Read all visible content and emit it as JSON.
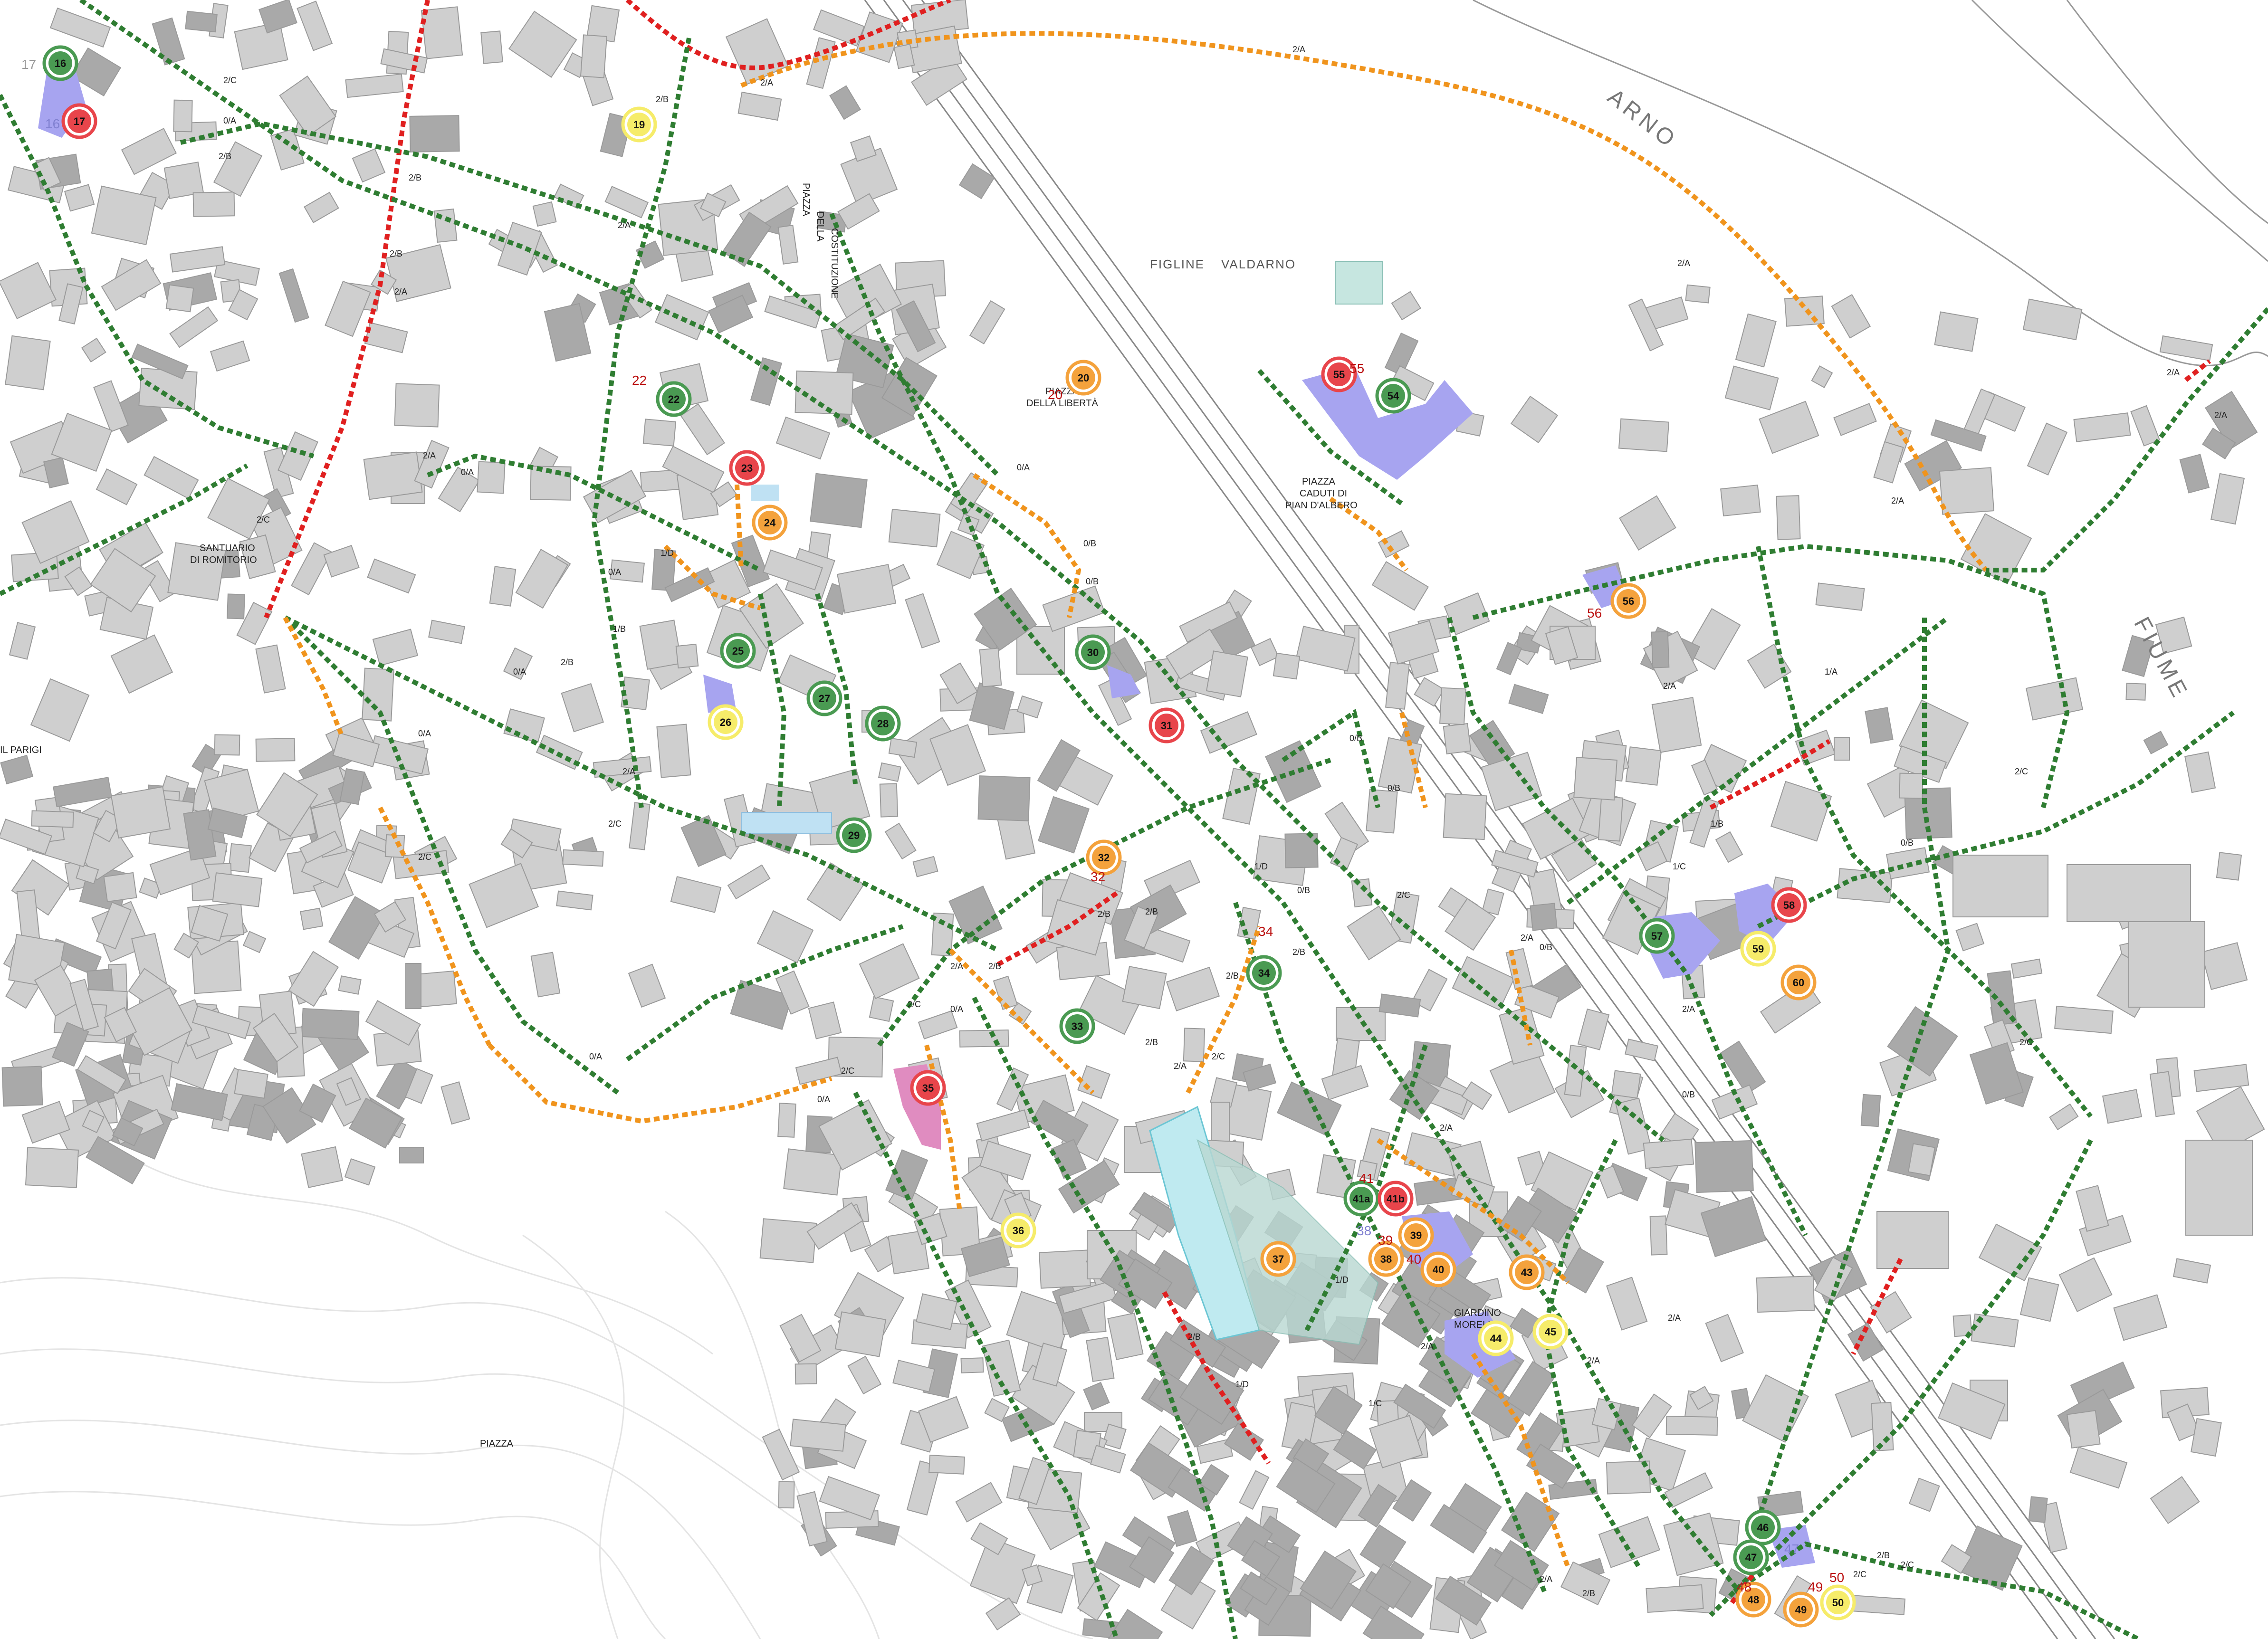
{
  "colors": {
    "green_route": "#2f7d32",
    "orange_route": "#f0941d",
    "red_route": "#e02020",
    "building": "#cfcfcf",
    "building_dark": "#a9a9a9",
    "water": "#bfeaf0",
    "purple_area": "#a7a4f0",
    "pink_area": "#e08cc0",
    "poi_green": "#4a9a52",
    "poi_orange": "#f4a23c",
    "poi_red": "#e8454b",
    "poi_yellow": "#f6ec6a"
  },
  "labels": {
    "river_arno": "ARNO",
    "river_fiume": "FIUME",
    "figline": "FIGLINE",
    "valdarno": "VALDARNO",
    "piazza_liberta_1": "PIAZZA",
    "piazza_liberta_2": "DELLA LIBERTÀ",
    "piazza_caduti_1": "PIAZZA",
    "piazza_caduti_2": "CADUTI DI",
    "piazza_caduti_3": "PIAN D'ALBERO",
    "piazza_costituzione_1": "PIAZZA",
    "piazza_costituzione_2": "DELLA",
    "piazza_costituzione_3": "COSTITUZIONE",
    "il_parigi": "IL PARIGI",
    "piazza_bottom": "PIAZZA",
    "giardino_1": "GIARDINO",
    "giardino_2": "MORELLI",
    "santuario_1": "SANTUARIO",
    "santuario_2": "DI ROMITORIO"
  },
  "route_labels": [
    "2/A",
    "2/B",
    "2/C",
    "0/A",
    "0/B",
    "1/A",
    "1/B",
    "1/C",
    "1/D"
  ],
  "pois": [
    {
      "id": "16",
      "color": "green"
    },
    {
      "id": "17",
      "color": "red"
    },
    {
      "id": "19",
      "color": "yellow"
    },
    {
      "id": "20",
      "color": "orange"
    },
    {
      "id": "22",
      "color": "green"
    },
    {
      "id": "23",
      "color": "red"
    },
    {
      "id": "24",
      "color": "orange"
    },
    {
      "id": "25",
      "color": "green"
    },
    {
      "id": "26",
      "color": "yellow"
    },
    {
      "id": "27",
      "color": "green"
    },
    {
      "id": "28",
      "color": "green"
    },
    {
      "id": "29",
      "color": "green"
    },
    {
      "id": "30",
      "color": "green"
    },
    {
      "id": "31",
      "color": "red"
    },
    {
      "id": "32",
      "color": "orange"
    },
    {
      "id": "33",
      "color": "green"
    },
    {
      "id": "34",
      "color": "green"
    },
    {
      "id": "35",
      "color": "red"
    },
    {
      "id": "36",
      "color": "yellow"
    },
    {
      "id": "37",
      "color": "orange"
    },
    {
      "id": "38",
      "color": "orange"
    },
    {
      "id": "39",
      "color": "orange"
    },
    {
      "id": "40",
      "color": "orange"
    },
    {
      "id": "41a",
      "color": "green"
    },
    {
      "id": "41b",
      "color": "red"
    },
    {
      "id": "43",
      "color": "orange"
    },
    {
      "id": "44",
      "color": "yellow"
    },
    {
      "id": "45",
      "color": "yellow"
    },
    {
      "id": "46",
      "color": "green"
    },
    {
      "id": "47",
      "color": "green"
    },
    {
      "id": "48",
      "color": "orange"
    },
    {
      "id": "49",
      "color": "orange"
    },
    {
      "id": "50",
      "color": "yellow"
    },
    {
      "id": "54",
      "color": "green"
    },
    {
      "id": "55",
      "color": "red"
    },
    {
      "id": "56",
      "color": "orange"
    },
    {
      "id": "57",
      "color": "green"
    },
    {
      "id": "58",
      "color": "red"
    },
    {
      "id": "59",
      "color": "yellow"
    },
    {
      "id": "60",
      "color": "orange"
    }
  ],
  "side_numbers": [
    "17",
    "16",
    "22",
    "20",
    "32",
    "34",
    "41",
    "38",
    "39",
    "40",
    "47",
    "48",
    "49",
    "50",
    "56",
    "55"
  ]
}
